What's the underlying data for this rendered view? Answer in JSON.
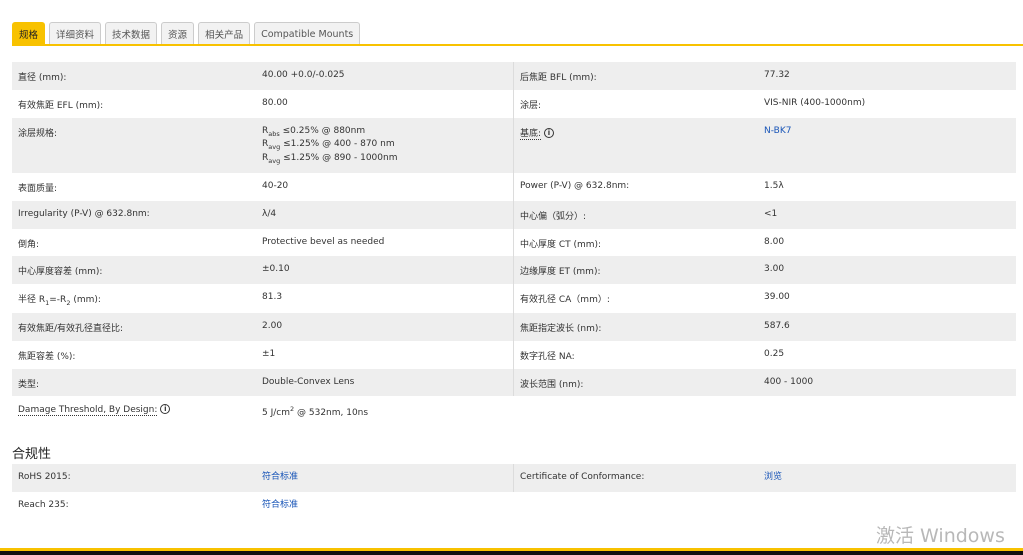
{
  "tabs": [
    "规格",
    "详细资料",
    "技术数据",
    "资源",
    "相关产品",
    "Compatible Mounts"
  ],
  "specs": {
    "r1": {
      "l1": "直径 (mm):",
      "v1": "40.00 +0.0/-0.025",
      "l2": "后焦距 BFL (mm):",
      "v2": "77.32"
    },
    "r2": {
      "l1": "有效焦距 EFL (mm):",
      "v1": "80.00",
      "l2": "涂层:",
      "v2": "VIS-NIR (400-1000nm)"
    },
    "r3": {
      "l1": "涂层规格:",
      "v1a_sym": "R",
      "v1a_sub": "abs",
      "v1a": " ≤0.25% @ 880nm",
      "v1b_sym": "R",
      "v1b_sub": "avg",
      "v1b": " ≤1.25% @ 400 - 870 nm",
      "v1c_sym": "R",
      "v1c_sub": "avg",
      "v1c": " ≤1.25% @ 890 - 1000nm",
      "l2": "基底:",
      "v2": "N-BK7"
    },
    "r4": {
      "l1": "表面质量:",
      "v1": "40-20",
      "l2": "Power (P-V) @ 632.8nm:",
      "v2": "1.5λ"
    },
    "r5": {
      "l1": "Irregularity (P-V) @ 632.8nm:",
      "v1": "λ/4",
      "l2": "中心偏（弧分）:",
      "v2": "<1"
    },
    "r6": {
      "l1": "倒角:",
      "v1": "Protective bevel as needed",
      "l2": "中心厚度 CT (mm):",
      "v2": "8.00"
    },
    "r7": {
      "l1": "中心厚度容差 (mm):",
      "v1": "±0.10",
      "l2": "边缘厚度 ET (mm):",
      "v2": "3.00"
    },
    "r8": {
      "l1a": "半径 R",
      "l1s1": "1",
      "l1b": "=-R",
      "l1s2": "2",
      "l1c": " (mm):",
      "v1": "81.3",
      "l2": "有效孔径 CA（mm）:",
      "v2": "39.00"
    },
    "r9": {
      "l1": "有效焦距/有效孔径直径比:",
      "v1": "2.00",
      "l2": "焦距指定波长 (nm):",
      "v2": "587.6"
    },
    "r10": {
      "l1": "焦距容差 (%):",
      "v1": "±1",
      "l2": "数字孔径 NA:",
      "v2": "0.25"
    },
    "r11": {
      "l1": "类型:",
      "v1": "Double-Convex Lens",
      "l2": "波长范围 (nm):",
      "v2": "400 - 1000"
    },
    "r12": {
      "l1": "Damage Threshold, By Design:",
      "v1a": "5 J/cm",
      "v1sup": "2",
      "v1b": " @ 532nm, 10ns"
    }
  },
  "compliance": {
    "title": "合规性",
    "rohs_label": "RoHS 2015:",
    "rohs_value": "符合标准",
    "coc_label": "Certificate of Conformance:",
    "coc_value": "浏览",
    "reach_label": "Reach 235:",
    "reach_value": "符合标准"
  },
  "watermark": "激活 Windows",
  "info_glyph": "i"
}
